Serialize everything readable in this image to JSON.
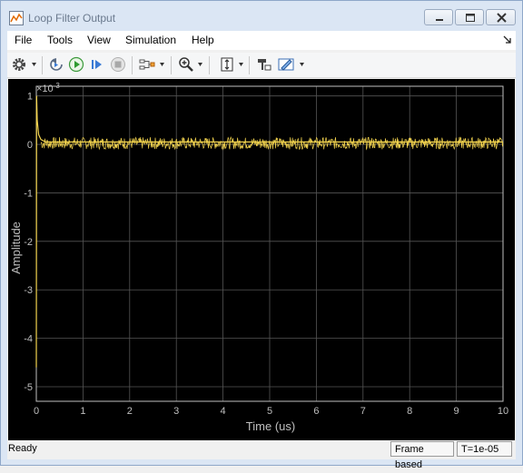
{
  "window": {
    "title": "Loop Filter Output"
  },
  "menu": {
    "items": [
      "File",
      "Tools",
      "View",
      "Simulation",
      "Help"
    ]
  },
  "toolbar": {
    "icons": [
      "gear-icon",
      "step-back-icon",
      "run-icon",
      "step-forward-icon",
      "stop-icon",
      "signal-select-icon",
      "zoom-in-icon",
      "scale-axes-icon",
      "cursor-measure-icon",
      "highlight-block-icon"
    ]
  },
  "colors": {
    "trace": "#f2d34e",
    "plot_bg": "#000000",
    "grid": "#555555",
    "axis_text": "#bfbfbf"
  },
  "chart_data": {
    "type": "line",
    "title": "",
    "xlabel": "Time (us)",
    "ylabel": "Amplitude",
    "y_exponent_label": "×10",
    "y_exponent_value": "-3",
    "xlim": [
      0,
      10
    ],
    "ylim": [
      -5.3,
      1.2
    ],
    "x_ticks": [
      "0",
      "1",
      "2",
      "3",
      "4",
      "5",
      "6",
      "7",
      "8",
      "9",
      "10"
    ],
    "y_ticks": [
      "1",
      "0",
      "-1",
      "-2",
      "-3",
      "-4",
      "-5"
    ],
    "y_tick_values": [
      1,
      0,
      -1,
      -2,
      -3,
      -4,
      -5
    ],
    "grid": true,
    "series": [
      {
        "x": [
          0,
          0.005,
          0.02,
          0.05,
          0.1,
          0.2,
          0.5,
          1,
          2,
          3,
          4,
          5,
          6,
          7,
          8,
          9,
          10
        ],
        "y": [
          -4.6,
          1.0,
          0.5,
          0.2,
          0.1,
          0.05,
          0.05,
          0.05,
          0.05,
          0.05,
          0.05,
          0.05,
          0.05,
          0.05,
          0.05,
          0.05,
          0.05
        ],
        "noise_band": [
          -0.1,
          0.15
        ]
      }
    ]
  },
  "status": {
    "ready": "Ready",
    "frame_mode": "Frame based",
    "sample_time": "T=1e-05"
  }
}
